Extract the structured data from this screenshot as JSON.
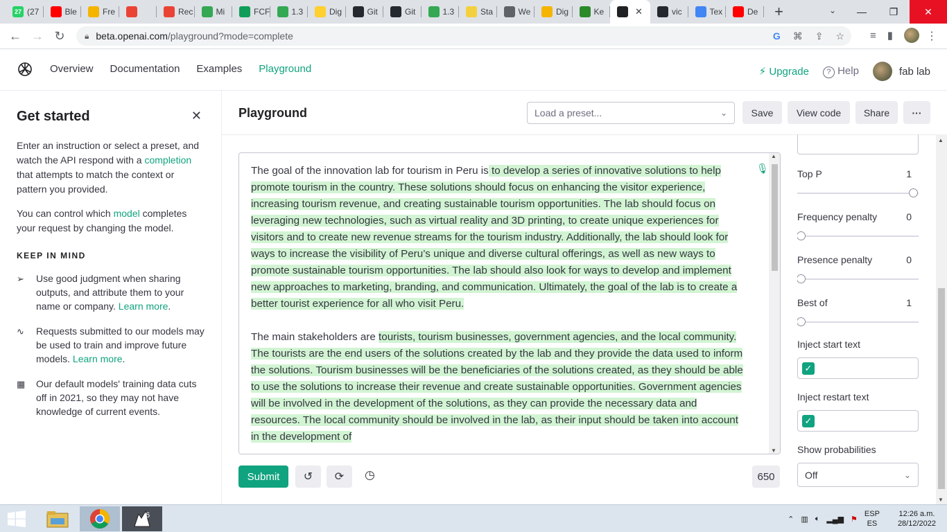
{
  "browser": {
    "tabs": [
      {
        "label": "(27",
        "icon": "whatsapp-icon",
        "color": "#25d366",
        "badge": "27"
      },
      {
        "label": "Ble",
        "icon": "youtube-icon",
        "color": "#ff0000"
      },
      {
        "label": "Fre",
        "icon": "slides-icon",
        "color": "#f4b400"
      },
      {
        "label": "",
        "icon": "gmail-icon",
        "color": "#ea4335"
      },
      {
        "label": "Rec",
        "icon": "gmail-icon",
        "color": "#ea4335"
      },
      {
        "label": "Mi",
        "icon": "drive-icon",
        "color": "#34a853"
      },
      {
        "label": "FCF",
        "icon": "sheets-plus-icon",
        "color": "#0f9d58"
      },
      {
        "label": "1.3",
        "icon": "drive-icon",
        "color": "#34a853"
      },
      {
        "label": "Dig",
        "icon": "miro-icon",
        "color": "#ffd02f"
      },
      {
        "label": "Git",
        "icon": "github-icon",
        "color": "#24292f"
      },
      {
        "label": "Git",
        "icon": "github-icon",
        "color": "#24292f"
      },
      {
        "label": "1.3",
        "icon": "drive-icon",
        "color": "#34a853"
      },
      {
        "label": "Sta",
        "icon": "notes-icon",
        "color": "#f4d03f"
      },
      {
        "label": "We",
        "icon": "globe-icon",
        "color": "#5f6368"
      },
      {
        "label": "Dig",
        "icon": "slides-icon",
        "color": "#f4b400"
      },
      {
        "label": "Ke",
        "icon": "kepler-icon",
        "color": "#2a8a2a"
      },
      {
        "label": "",
        "icon": "openai-icon",
        "color": "#202123",
        "active": true
      },
      {
        "label": "vic",
        "icon": "github-icon",
        "color": "#24292f"
      },
      {
        "label": "Tex",
        "icon": "brackets-icon",
        "color": "#4285f4"
      },
      {
        "label": "De",
        "icon": "youtube-icon",
        "color": "#ff0000"
      }
    ],
    "url_host": "beta.openai.com",
    "url_path": "/playground?mode=complete"
  },
  "header": {
    "nav": [
      "Overview",
      "Documentation",
      "Examples",
      "Playground"
    ],
    "upgrade": "Upgrade",
    "help": "Help",
    "org": "fab lab"
  },
  "sidebar": {
    "title": "Get started",
    "p1_pre": "Enter an instruction or select a preset, and watch the API respond with a ",
    "p1_link": "completion",
    "p1_post": " that attempts to match the context or pattern you provided.",
    "p2_pre": "You can control which ",
    "p2_link": "model",
    "p2_post": " completes your request by changing the model.",
    "keep_title": "KEEP IN MIND",
    "items": [
      {
        "icon": "send-icon",
        "text": "Use good judgment when sharing outputs, and attribute them to your name or company. ",
        "link": "Learn more",
        "after": "."
      },
      {
        "icon": "activity-icon",
        "text": "Requests submitted to our models may be used to train and improve future models. ",
        "link": "Learn more",
        "after": "."
      },
      {
        "icon": "calendar-icon",
        "text": "Our default models' training data cuts off in 2021, so they may not have knowledge of current events.",
        "link": "",
        "after": ""
      }
    ]
  },
  "playground": {
    "title": "Playground",
    "preset_placeholder": "Load a preset...",
    "save": "Save",
    "view_code": "View code",
    "share": "Share",
    "more": "···",
    "p1_prompt": "The goal of the innovation lab for tourism in Peru is",
    "p1_completion": " to develop a series of innovative solutions to help promote tourism in the country. These solutions should focus on enhancing the visitor experience, increasing tourism revenue, and creating sustainable tourism opportunities. The lab should focus on leveraging new technologies, such as virtual reality and 3D printing, to create unique experiences for visitors and to create new revenue streams for the tourism industry. Additionally, the lab should look for ways to increase the visibility of Peru’s unique and diverse cultural offerings, as well as new ways to promote sustainable tourism opportunities. The lab should also look for ways to develop and implement new approaches to marketing, branding, and communication. Ultimately, the goal of the lab is to create a better tourist experience for all who visit Peru.",
    "p2_prompt": "The main stakeholders are ",
    "p2_completion": " tourists, tourism businesses, government agencies, and the local community. The tourists are the end users of the solutions created by the lab and they provide the data used to inform the solutions. Tourism businesses will be the beneficiaries of the solutions created, as they should be able to use the solutions to increase their revenue and create sustainable opportunities. Government agencies will be involved in the development of the solutions, as they can provide the necessary data and resources. The local community should be involved in the lab, as their input should be taken into account in the development of",
    "submit": "Submit",
    "token_count": "650"
  },
  "settings": {
    "top_p_label": "Top P",
    "top_p_value": "1",
    "top_p_level": 1.0,
    "freq_label": "Frequency penalty",
    "freq_value": "0",
    "freq_level": 0.0,
    "pres_label": "Presence penalty",
    "pres_value": "0",
    "pres_level": 0.0,
    "best_label": "Best of",
    "best_value": "1",
    "best_level": 0.0,
    "inject_start_label": "Inject start text",
    "inject_restart_label": "Inject restart text",
    "show_prob_label": "Show probabilities",
    "show_prob_value": "Off"
  },
  "taskbar": {
    "lang_top": "ESP",
    "lang_bottom": "ES",
    "time": "12:26 a.m.",
    "date": "28/12/2022"
  },
  "colors": {
    "accent": "#10a37f",
    "highlight": "#d2f4d3"
  }
}
